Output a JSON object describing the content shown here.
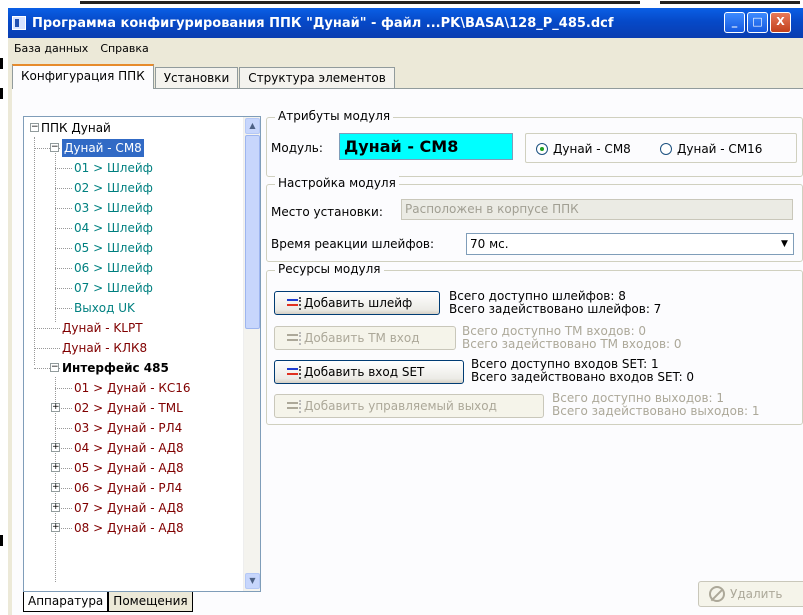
{
  "window": {
    "title": "Программа конфигурирования ППК \"Дунай\"  -  файл ...PK\\BASA\\128_P_485.dcf",
    "minimize_icon": "minimize-icon",
    "maximize_icon": "maximize-icon",
    "close_icon": "close-icon"
  },
  "menu": [
    "База данных",
    "Справка"
  ],
  "tabs": [
    {
      "label": "Конфигурация ППК",
      "active": true
    },
    {
      "label": "Установки",
      "active": false
    },
    {
      "label": "Структура элементов",
      "active": false
    }
  ],
  "tree": {
    "items": [
      {
        "label": "ППК Дунай",
        "level": 0,
        "expander": "minus",
        "color": "#000000",
        "bold": false
      },
      {
        "label": "Дунай - СМ8",
        "level": 1,
        "expander": "minus",
        "color": "#ffffff",
        "bold": false,
        "selected": true
      },
      {
        "label": "01 > Шлейф",
        "level": 2,
        "color": "#008080"
      },
      {
        "label": "02 > Шлейф",
        "level": 2,
        "color": "#008080"
      },
      {
        "label": "03 > Шлейф",
        "level": 2,
        "color": "#008080"
      },
      {
        "label": "04 > Шлейф",
        "level": 2,
        "color": "#008080"
      },
      {
        "label": "05 > Шлейф",
        "level": 2,
        "color": "#008080"
      },
      {
        "label": "06 > Шлейф",
        "level": 2,
        "color": "#008080"
      },
      {
        "label": "07 > Шлейф",
        "level": 2,
        "color": "#008080"
      },
      {
        "label": "Выход UK",
        "level": 2,
        "color": "#008080"
      },
      {
        "label": "Дунай - KLPT",
        "level": 1,
        "color": "#800000"
      },
      {
        "label": "Дунай - КЛК8",
        "level": 1,
        "color": "#800000"
      },
      {
        "label": "Интерфейс 485",
        "level": 1,
        "expander": "minus",
        "color": "#000000",
        "bold": true
      },
      {
        "label": "01 > Дунай - КС16",
        "level": 2,
        "color": "#800000"
      },
      {
        "label": "02 > Дунай - TML",
        "level": 2,
        "expander": "plus",
        "color": "#800000"
      },
      {
        "label": "03 > Дунай - РЛ4",
        "level": 2,
        "color": "#800000"
      },
      {
        "label": "04 > Дунай - АД8",
        "level": 2,
        "expander": "plus",
        "color": "#800000"
      },
      {
        "label": "05 > Дунай - АД8",
        "level": 2,
        "expander": "plus",
        "color": "#800000"
      },
      {
        "label": "06 > Дунай - РЛ4",
        "level": 2,
        "expander": "plus",
        "color": "#800000"
      },
      {
        "label": "07 > Дунай - АД8",
        "level": 2,
        "expander": "plus",
        "color": "#800000"
      },
      {
        "label": "08 > Дунай - АД8",
        "level": 2,
        "expander": "plus",
        "color": "#800000"
      }
    ],
    "bottom_tabs": [
      "Аппаратура",
      "Помещения"
    ]
  },
  "attributes": {
    "group_title": "Атрибуты модуля",
    "module_label": "Модуль:",
    "module_value": "Дунай - СМ8",
    "radio_options": [
      {
        "label": "Дунай - СМ8",
        "selected": true
      },
      {
        "label": "Дунай - СМ16",
        "selected": false
      }
    ]
  },
  "settings": {
    "group_title": "Настройка модуля",
    "location_label": "Место установки:",
    "location_value": "Расположен в корпусе ППК",
    "reaction_label": "Время реакции шлейфов:",
    "reaction_value": "70 мс."
  },
  "resources": {
    "group_title": "Ресурсы модуля",
    "items": [
      {
        "button": "Добавить шлейф",
        "enabled": true,
        "line1": "Всего доступно шлейфов: 8",
        "line2": "Всего задействовано шлейфов: 7"
      },
      {
        "button": "Добавить ТМ вход",
        "enabled": false,
        "line1": "Всего доступно ТМ входов:  0",
        "line2": "Всего задействовано ТМ входов:  0"
      },
      {
        "button": "Добавить вход SET",
        "enabled": true,
        "line1": "Всего доступно входов SET:  1",
        "line2": "Всего задействовано входов SET:  0"
      },
      {
        "button": "Добавить управляемый выход",
        "enabled": false,
        "line1": "Всего доступно выходов:  1",
        "line2": "Всего задействовано выходов:  1"
      }
    ]
  },
  "delete_button": "Удалить"
}
